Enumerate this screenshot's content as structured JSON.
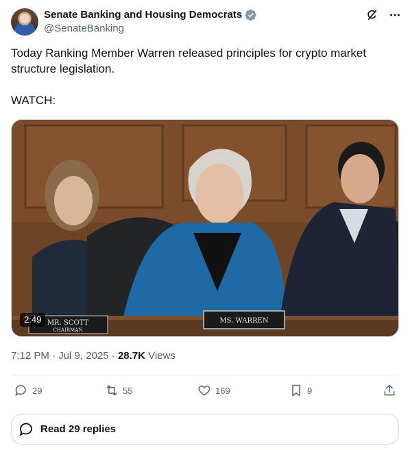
{
  "header": {
    "display_name": "Senate Banking and Housing Democrats",
    "handle": "@SenateBanking",
    "verified_color": "#829aab",
    "icons": [
      "grok-icon",
      "more-icon"
    ]
  },
  "tweet": {
    "text": "Today Ranking Member Warren released principles for crypto market structure legislation.\n\nWATCH:"
  },
  "media": {
    "duration": "2:49",
    "nameplate_left": "MR. SCOTT",
    "nameplate_left_sub": "CHAIRMAN",
    "nameplate_center": "MS. WARREN"
  },
  "meta": {
    "time": "7:12 PM",
    "date": "Jul 9, 2025",
    "views_count": "28.7K",
    "views_label": "Views",
    "separator": "·"
  },
  "actions": {
    "replies": "29",
    "reposts": "55",
    "likes": "169",
    "bookmarks": "9"
  },
  "read_replies": {
    "label": "Read 29 replies"
  },
  "colors": {
    "text": "#0f1419",
    "secondary": "#536471",
    "border": "#cfd9de"
  }
}
